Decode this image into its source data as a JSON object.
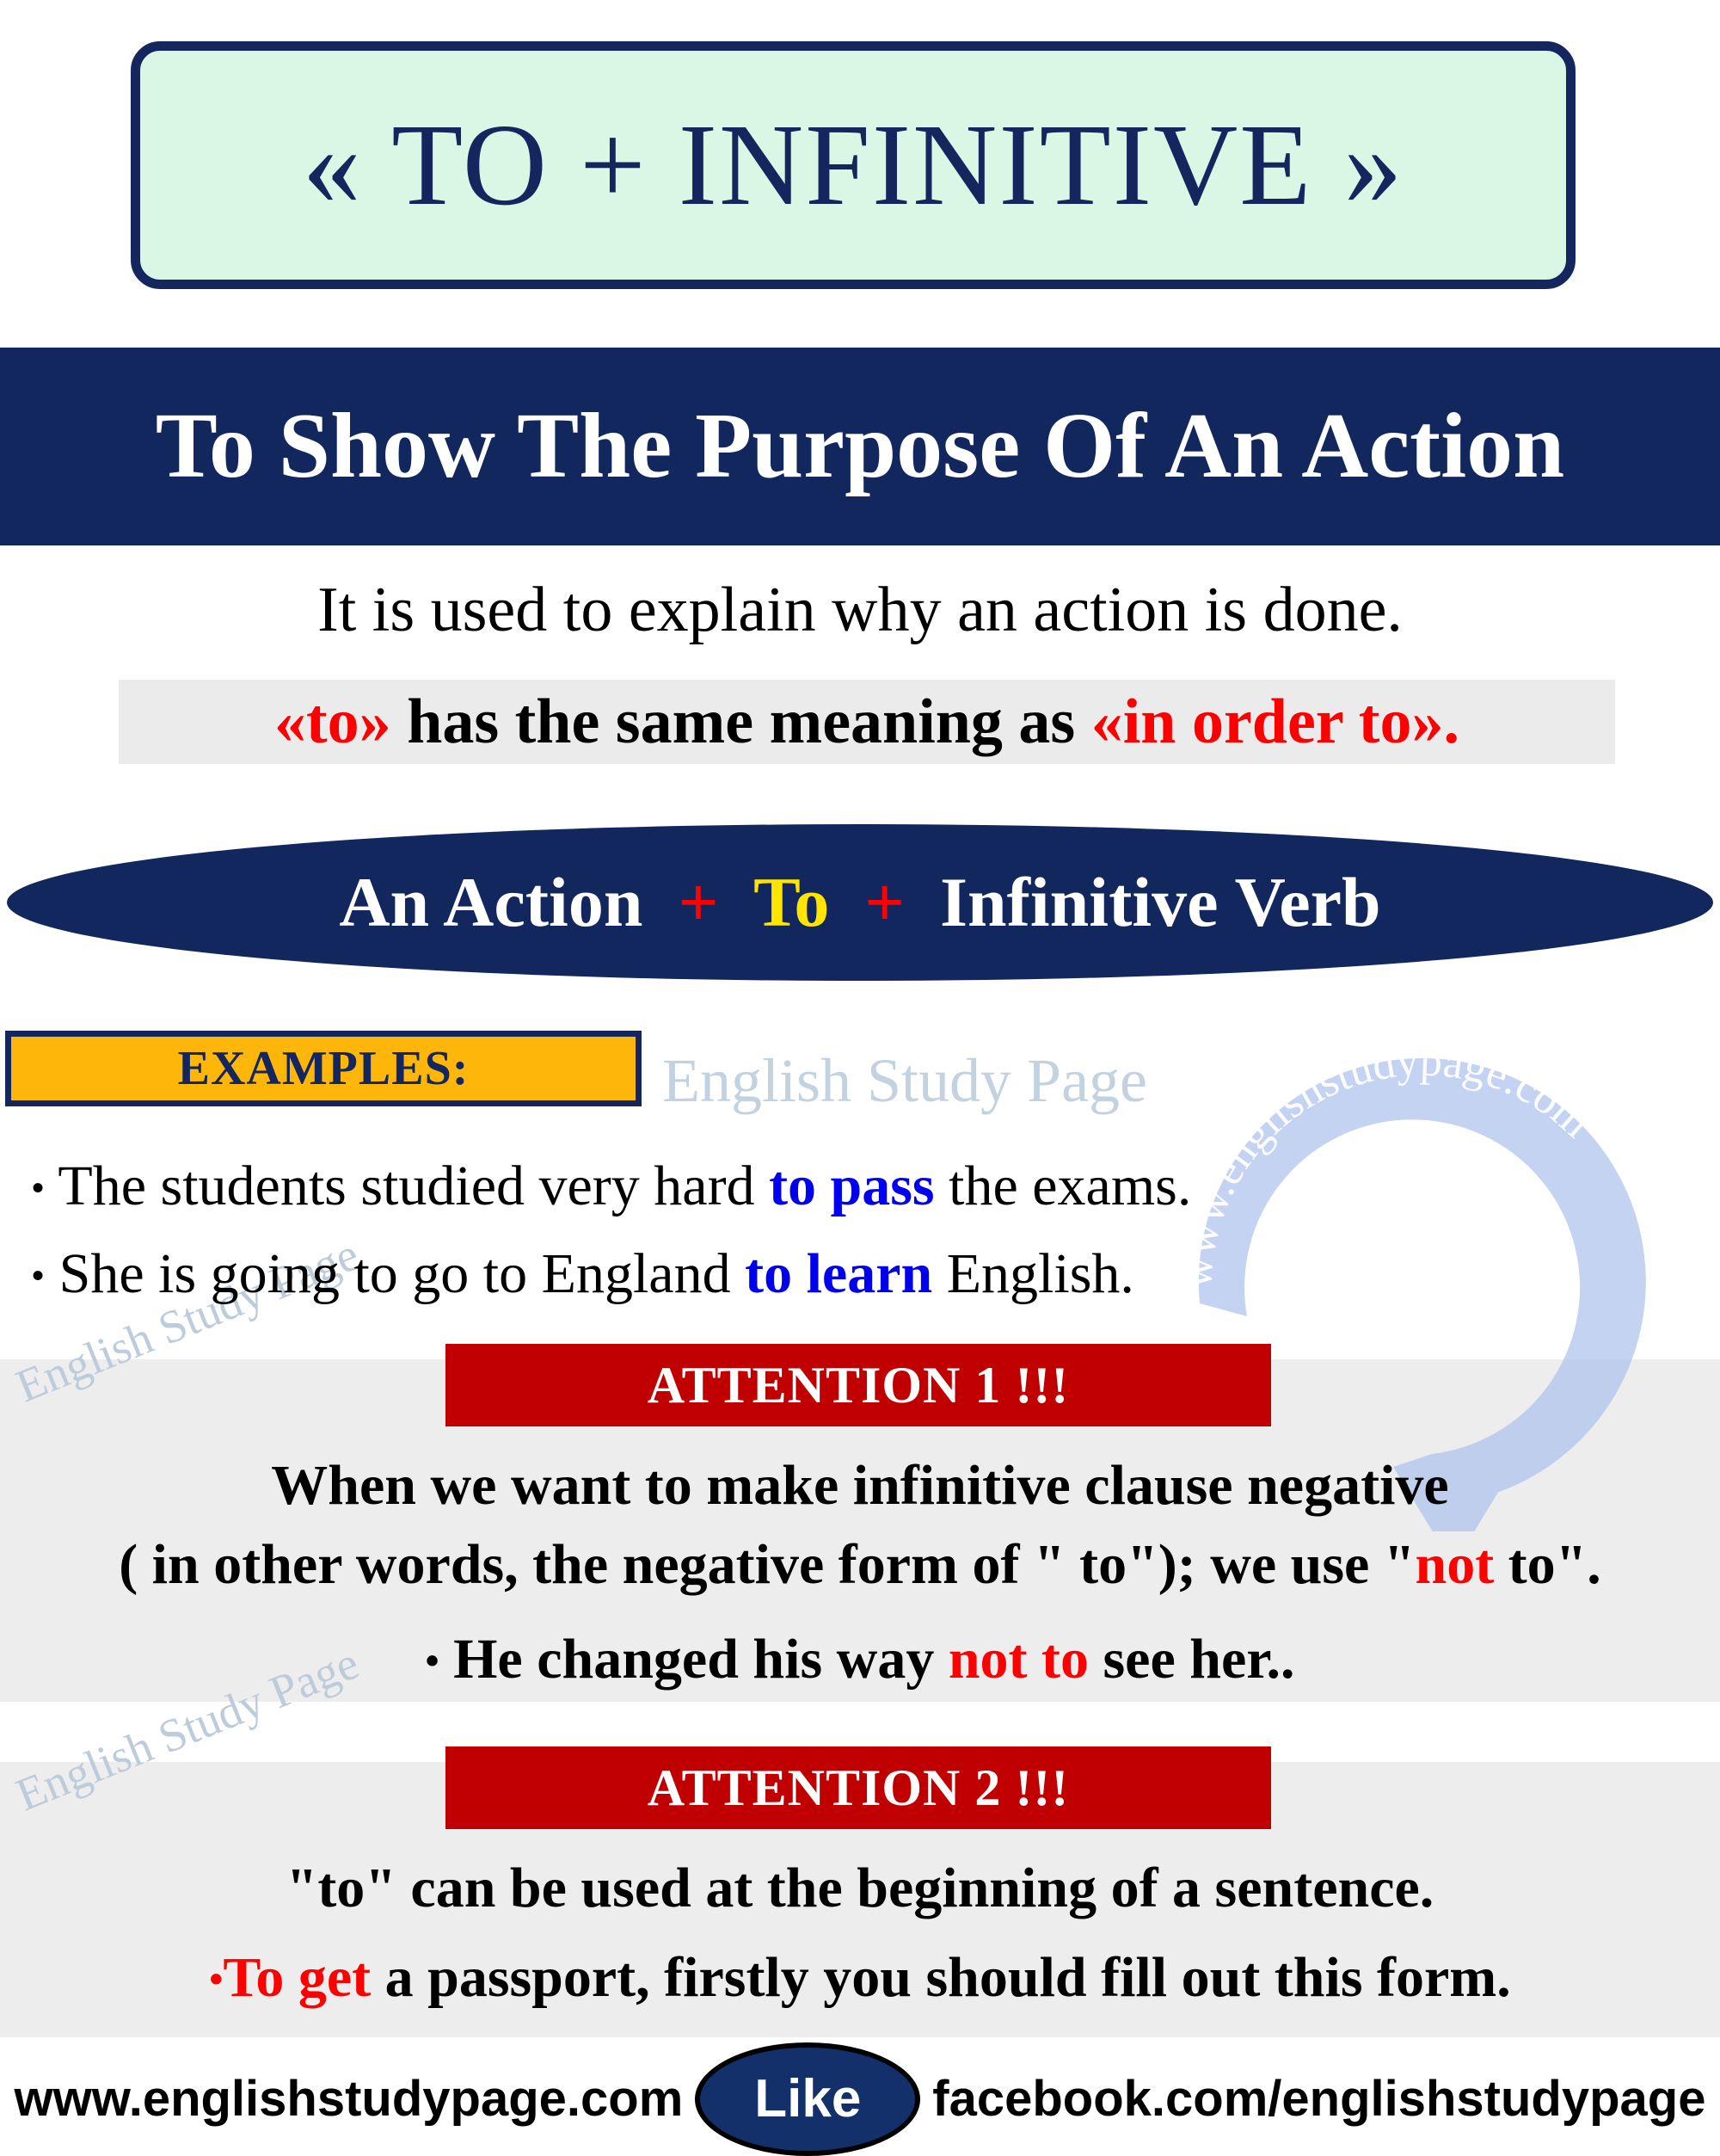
{
  "colors": {
    "navy": "#12275e",
    "mint": "#d9f7e4",
    "amber": "#ffb60a",
    "attention_red": "#c00000",
    "accent_red": "#ff0000",
    "accent_blue": "#0000ee",
    "accent_yellow": "#ffe400",
    "band_gray": "#ededed",
    "watermark_blue": "#bcccdb"
  },
  "title": {
    "text": "« TO + INFINITIVE »"
  },
  "banner": {
    "text": "To Show The Purpose Of An Action"
  },
  "explanation": {
    "line1": "It is used to explain why an action is done.",
    "line2_part1": "«to»",
    "line2_part2": " has the same meaning as ",
    "line2_part3": "«in order to»."
  },
  "formula": {
    "part1": "An Action",
    "plus1": "+",
    "part2": "To",
    "plus2": "+",
    "part3": "Infinitive Verb"
  },
  "examples": {
    "label": "EXAMPLES:",
    "items": [
      {
        "bullet": "•",
        "pre": " The students studied very hard ",
        "highlight": "to pass",
        "post": " the exams."
      },
      {
        "bullet": "•",
        "pre": " She is going to go to England ",
        "highlight": "to learn",
        "post": " English."
      }
    ]
  },
  "attention1": {
    "label": "ATTENTION 1 !!!",
    "line1": "When we want to make infinitive clause negative",
    "line2_pre": "( in other words, the negative form of  \" to\");  we use \"",
    "line2_highlight": "not",
    "line2_post": " to\".",
    "example_bullet": "•",
    "example_pre": "  He changed his way ",
    "example_highlight": "not to",
    "example_post": " see her.."
  },
  "attention2": {
    "label": "ATTENTION 2 !!!",
    "line1": "\"to\" can be used at the beginning of a sentence.",
    "example_bullet": "•",
    "example_highlight": "To get",
    "example_post": " a passport, firstly you should fill out this form."
  },
  "footer": {
    "website": "www.englishstudypage.com",
    "like": "Like",
    "facebook": "facebook.com/englishstudypage"
  },
  "watermarks": {
    "center": "English Study Page",
    "rotated_1": "English Study Page",
    "rotated_2": "English Study Page",
    "arc": "www.englishstudypage.com"
  }
}
